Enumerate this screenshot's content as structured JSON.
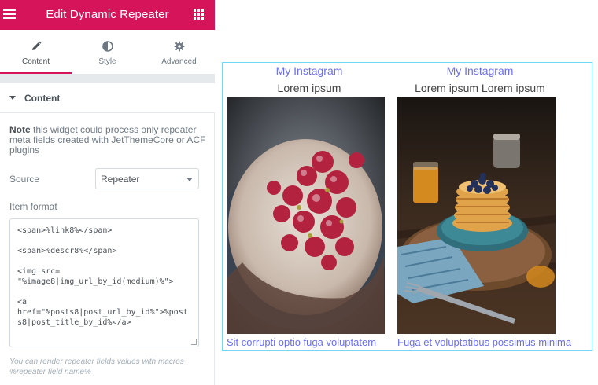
{
  "header": {
    "title": "Edit Dynamic Repeater",
    "menu_icon": "hamburger-menu-icon",
    "apps_icon": "grid-apps-icon"
  },
  "tabs": [
    {
      "label": "Content",
      "icon": "pencil-icon",
      "active": true
    },
    {
      "label": "Style",
      "icon": "half-circle-icon",
      "active": false
    },
    {
      "label": "Advanced",
      "icon": "gear-icon",
      "active": false
    }
  ],
  "section": {
    "title": "Content"
  },
  "note": {
    "bold": "Note",
    "text": " this widget could process only repeater meta fields created with JetThemeCore or ACF plugins"
  },
  "source": {
    "label": "Source",
    "value": "Repeater"
  },
  "item_format": {
    "label": "Item format",
    "value": "<span>%link8%</span>\n\n<span>%descr8%</span>\n\n<img src=\n\"%image8|img_url_by_id(medium)%\">\n\n<a\nhref=\"%posts8|post_url_by_id%\">%posts8|post_title_by_id%</a>"
  },
  "hint": "You can render repeater fields values with macros %repeater field name%",
  "preview": {
    "items": [
      {
        "link": "My Instagram",
        "descr": "Lorem ipsum",
        "image": "raspberry-cake-photo",
        "post": "Sit corrupti optio fuga voluptatem"
      },
      {
        "link": "My Instagram",
        "descr": "Lorem ipsum Lorem ipsum",
        "image": "blueberry-pancakes-photo",
        "post": "Fuga et voluptatibus possimus minima"
      }
    ]
  },
  "colors": {
    "brand": "#d5145a",
    "link": "#6a6ef0",
    "preview_border": "#71d7f7"
  }
}
